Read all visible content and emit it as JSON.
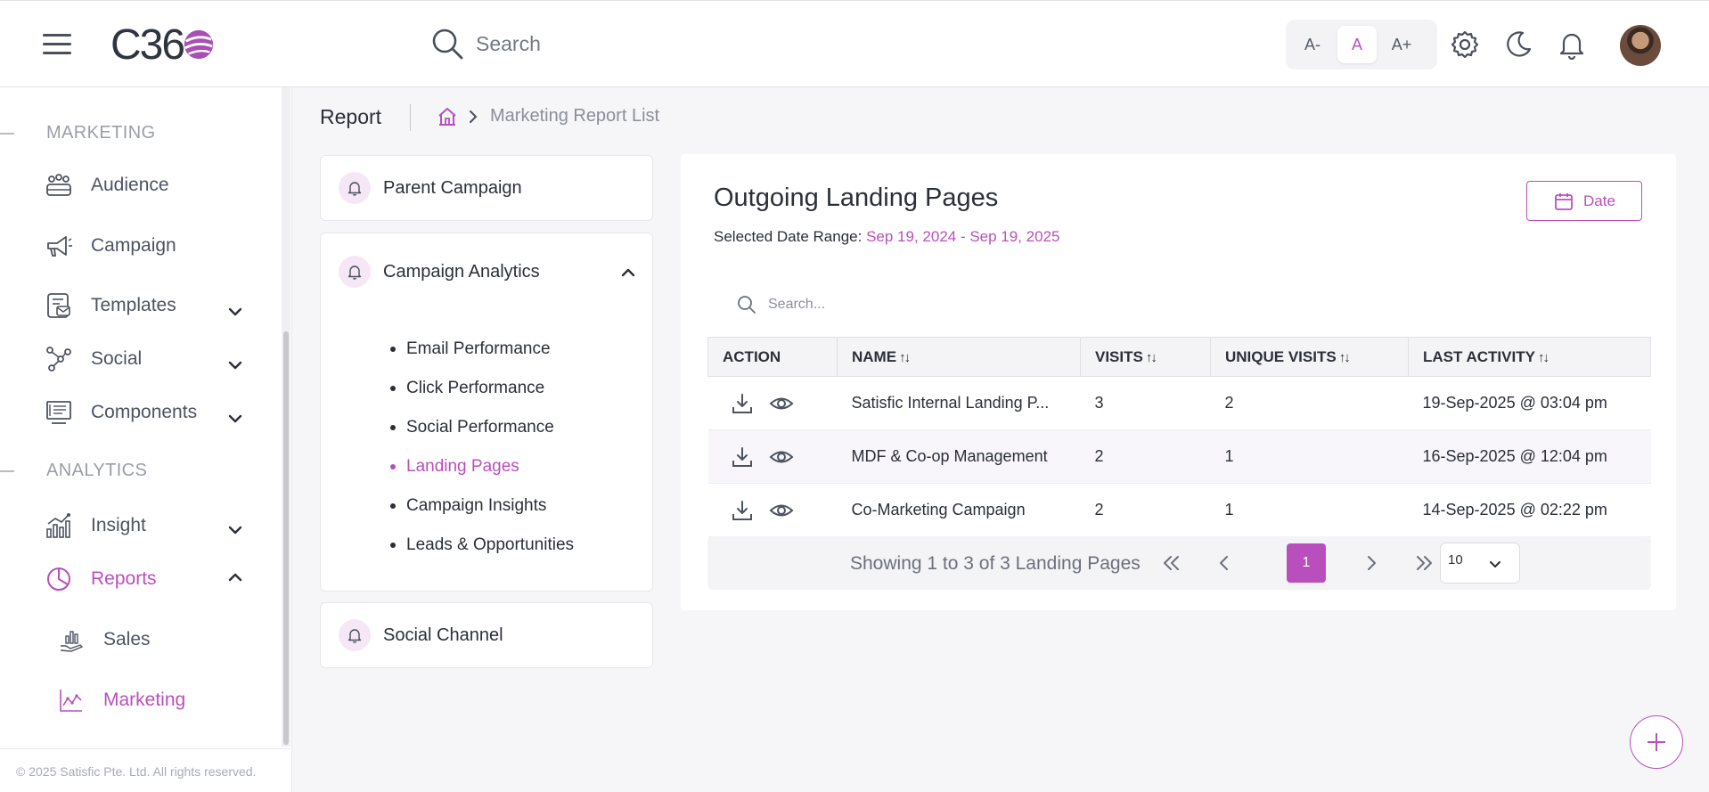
{
  "header": {
    "logo_text": "C36",
    "search_label": "Search",
    "font_sizes": [
      "A-",
      "A",
      "A+"
    ],
    "active_font_size": "A",
    "icons": [
      "menu-icon",
      "search-icon",
      "settings-icon",
      "moon-icon",
      "bell-icon"
    ]
  },
  "sidebar": {
    "sections": [
      {
        "title": "MARKETING"
      },
      {
        "title": "ANALYTICS"
      }
    ],
    "items": [
      {
        "label": "Audience",
        "icon": "audience-icon"
      },
      {
        "label": "Campaign",
        "icon": "megaphone-icon"
      },
      {
        "label": "Templates",
        "icon": "template-icon",
        "expandable": true
      },
      {
        "label": "Social",
        "icon": "social-icon",
        "expandable": true
      },
      {
        "label": "Components",
        "icon": "components-icon",
        "expandable": true
      },
      {
        "label": "Insight",
        "icon": "insight-icon",
        "expandable": true
      },
      {
        "label": "Reports",
        "icon": "pie-chart-icon",
        "expandable": true,
        "expanded": true,
        "active": true
      }
    ],
    "sub_items": [
      {
        "label": "Sales",
        "icon": "sales-icon"
      },
      {
        "label": "Marketing",
        "icon": "line-chart-icon",
        "active": true
      }
    ],
    "footer": "© 2025 Satisfic Pte. Ltd. All rights reserved."
  },
  "breadcrumb": {
    "title": "Report",
    "current": "Marketing Report List"
  },
  "report_nav": {
    "parent_campaign": "Parent Campaign",
    "campaign_analytics": "Campaign Analytics",
    "campaign_analytics_items": [
      "Email Performance",
      "Click Performance",
      "Social Performance",
      "Landing Pages",
      "Campaign Insights",
      "Leads & Opportunities"
    ],
    "active_item": "Landing Pages",
    "social_channel": "Social Channel"
  },
  "main": {
    "title": "Outgoing Landing Pages",
    "range_label": "Selected Date Range:",
    "range_value": "Sep 19, 2024 - Sep 19, 2025",
    "date_button": "Date",
    "search_placeholder": "Search...",
    "columns": [
      "ACTION",
      "NAME",
      "VISITS",
      "UNIQUE VISITS",
      "LAST ACTIVITY"
    ],
    "sort_glyph": "↑↓",
    "rows": [
      {
        "name": "Satisfic Internal Landing P...",
        "visits": "3",
        "unique_visits": "2",
        "last_activity": "19-Sep-2025 @ 03:04 pm"
      },
      {
        "name": "MDF & Co-op Management",
        "visits": "2",
        "unique_visits": "1",
        "last_activity": "16-Sep-2025 @ 12:04 pm"
      },
      {
        "name": "Co-Marketing Campaign",
        "visits": "2",
        "unique_visits": "1",
        "last_activity": "14-Sep-2025 @ 02:22 pm"
      }
    ],
    "pagination": {
      "info": "Showing 1 to 3 of 3 Landing Pages",
      "current_page": "1",
      "page_size": "10"
    }
  },
  "colors": {
    "accent": "#b94fbd",
    "text": "#2b2f38",
    "muted": "#8a8e98"
  }
}
